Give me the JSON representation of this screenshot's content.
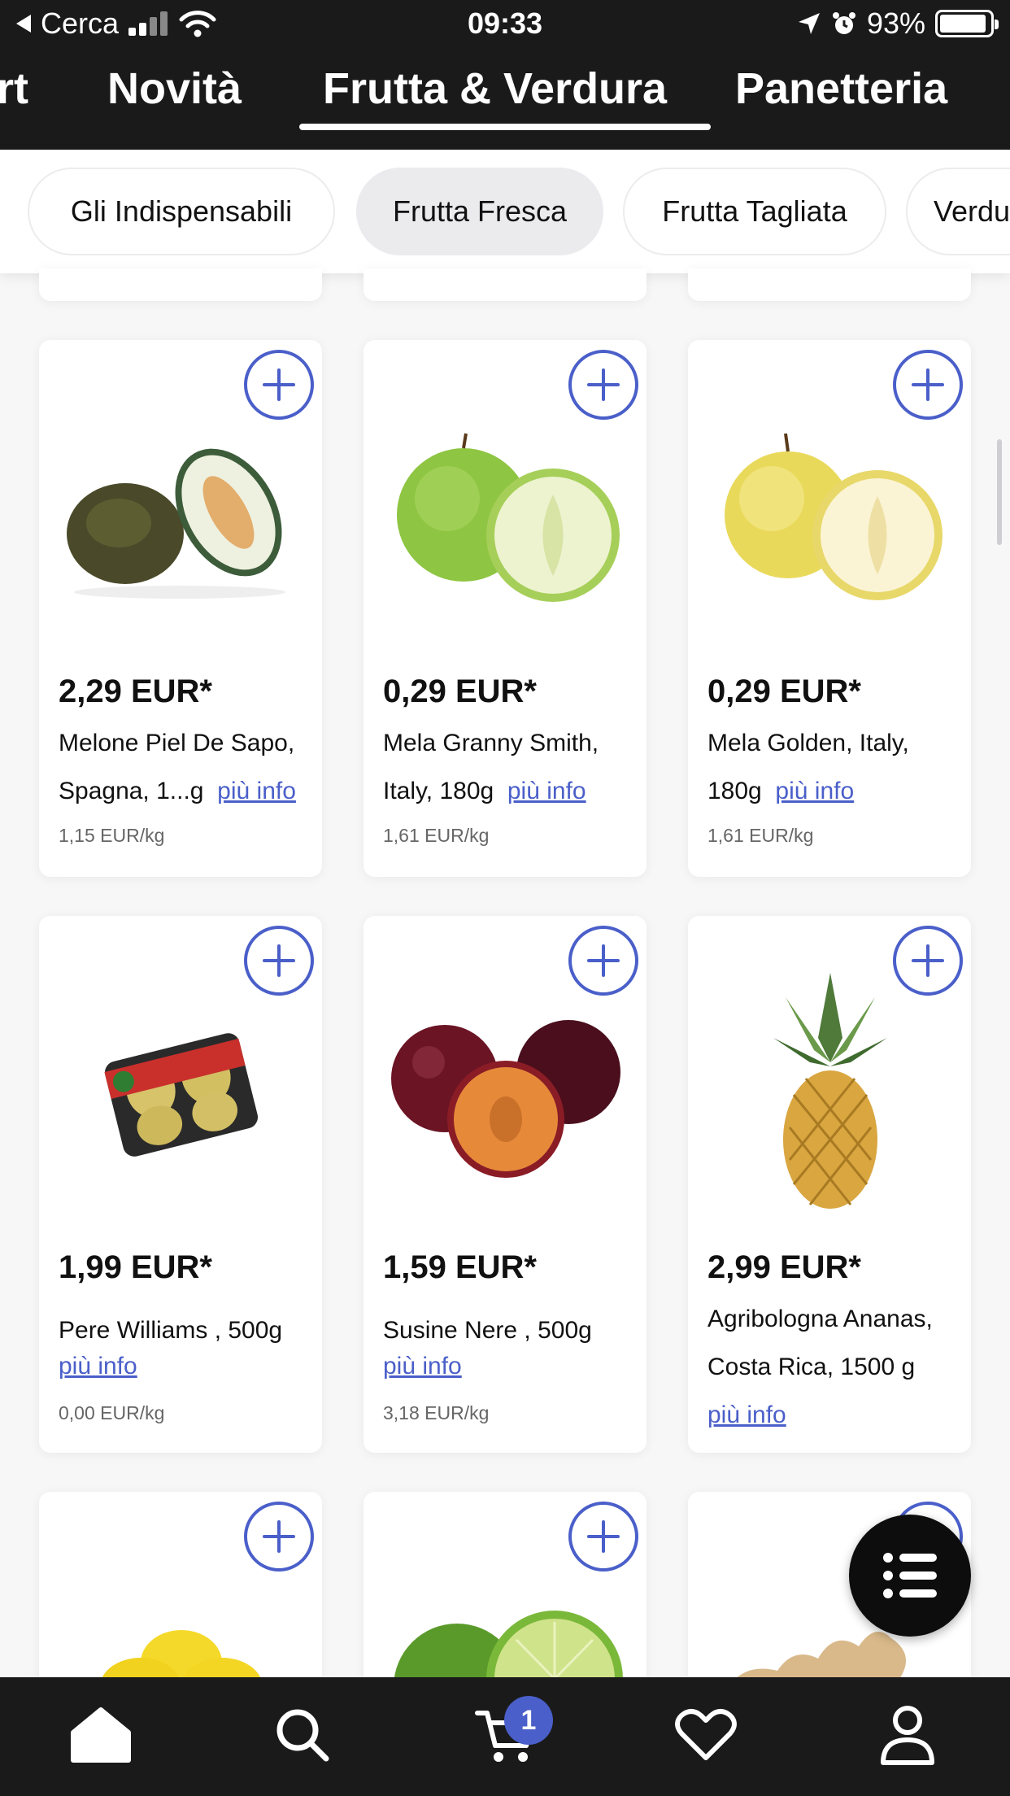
{
  "status_bar": {
    "back_label": "Cerca",
    "time": "09:33",
    "battery": "93%",
    "battery_level": 0.93
  },
  "category_tabs": [
    {
      "label": "rt",
      "active": false
    },
    {
      "label": "Novità",
      "active": false
    },
    {
      "label": "Frutta & Verdura",
      "active": true
    },
    {
      "label": "Panetteria",
      "active": false
    }
  ],
  "sub_tabs": [
    {
      "label": "Gli Indispensabili",
      "active": false
    },
    {
      "label": "Frutta Fresca",
      "active": true
    },
    {
      "label": "Frutta Tagliata",
      "active": false
    },
    {
      "label": "Verdu",
      "active": false
    }
  ],
  "products": [
    {
      "price": "2,29 EUR*",
      "name": "Melone Piel De Sapo, Spagna, 1...g",
      "more": "più info",
      "unit_price": "1,15 EUR/kg",
      "icon": "melon-image"
    },
    {
      "price": "0,29 EUR*",
      "name": "Mela Granny Smith, Italy, 180g",
      "more": "più info",
      "unit_price": "1,61 EUR/kg",
      "icon": "green-apple-image"
    },
    {
      "price": "0,29 EUR*",
      "name": "Mela Golden, Italy, 180g",
      "more": "più info",
      "unit_price": "1,61 EUR/kg",
      "icon": "golden-apple-image"
    },
    {
      "price": "1,99 EUR*",
      "name": " Pere Williams , 500g",
      "more": "più info",
      "unit_price": "0,00 EUR/kg",
      "icon": "pears-pack-image"
    },
    {
      "price": "1,59 EUR*",
      "name": " Susine Nere , 500g",
      "more": "più info",
      "unit_price": "3,18 EUR/kg",
      "icon": "plums-image"
    },
    {
      "price": "2,99 EUR*",
      "name": "Agribologna Ananas, Costa Rica, 1500 g",
      "more": "più info",
      "unit_price": "",
      "icon": "pineapple-image"
    }
  ],
  "partial_products": [
    {
      "icon": "lemons-image"
    },
    {
      "icon": "lime-image"
    },
    {
      "icon": "ginger-image"
    }
  ],
  "bottom_nav": [
    {
      "icon": "home-icon"
    },
    {
      "icon": "search-icon"
    },
    {
      "icon": "cart-icon",
      "badge": "1"
    },
    {
      "icon": "heart-icon"
    },
    {
      "icon": "profile-icon"
    }
  ],
  "colors": {
    "accent": "#4a5fc9",
    "dark": "#1a1a1a"
  }
}
